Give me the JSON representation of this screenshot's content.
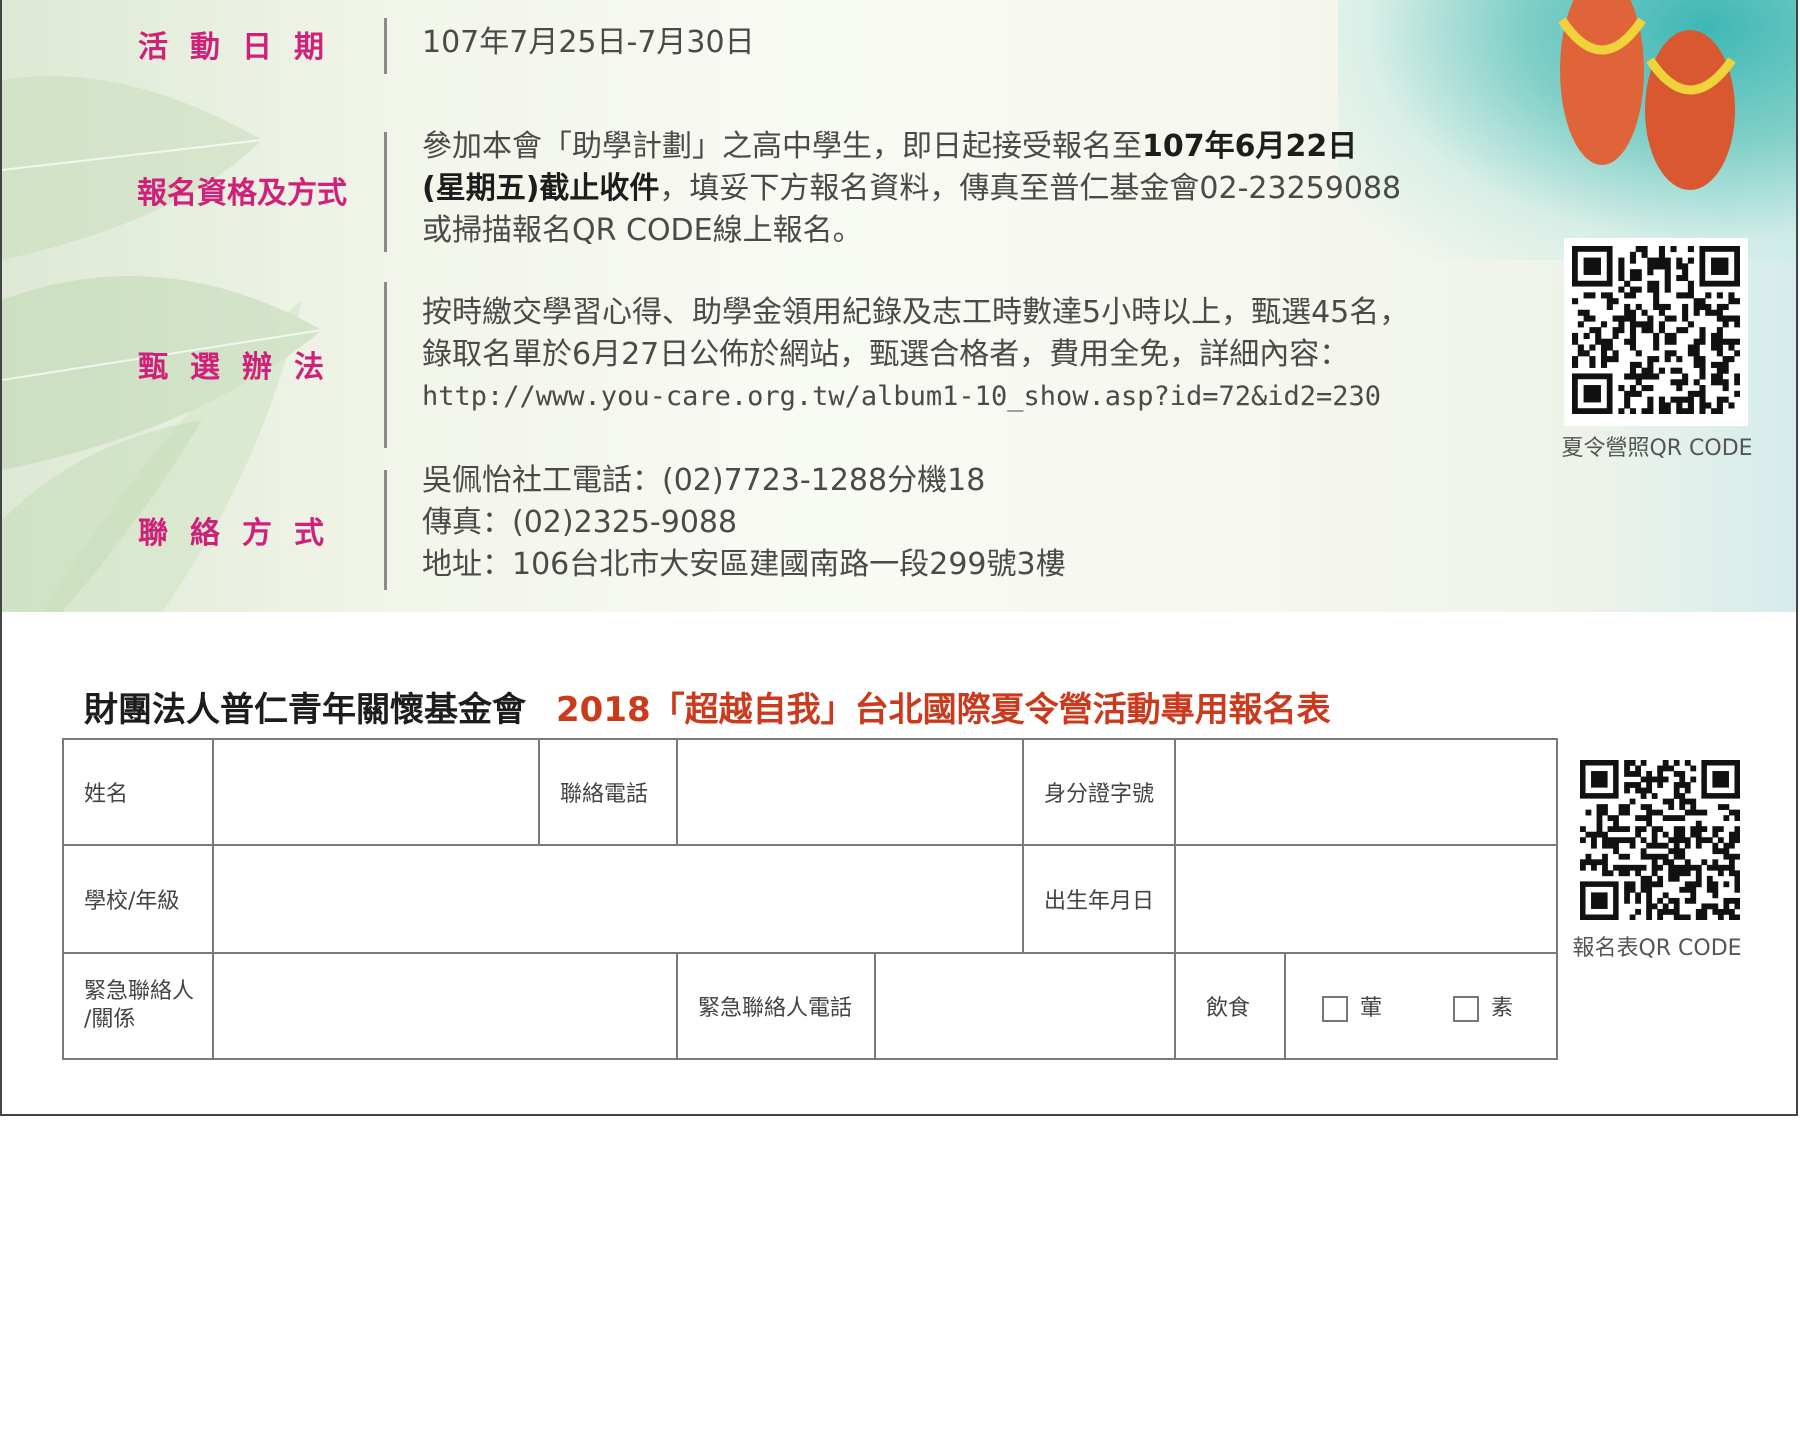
{
  "event_info": {
    "rows": [
      {
        "label": "活動日期",
        "lines": [
          "107年7月25日-7月30日"
        ]
      },
      {
        "label": "報名資格及方式",
        "line1_pre": "參加本會「助學計劃」之高中學生，即日起接受報名至",
        "line1_bold": "107年6月22日",
        "line2_bold": "(星期五)截止收件",
        "line2_post": "，填妥下方報名資料，傳真至普仁基金會02-23259088",
        "line3": "或掃描報名QR CODE線上報名。"
      },
      {
        "label": "甄選辦法",
        "lines": [
          "按時繳交學習心得、助學金領用紀錄及志工時數達5小時以上，甄選45名，",
          "錄取名單於6月27日公佈於網站，甄選合格者，費用全免，詳細內容：",
          "http://www.you-care.org.tw/album1-10_show.asp?id=72&id2=230"
        ]
      },
      {
        "label": "聯絡方式",
        "lines": [
          "吳佩怡社工電話：(02)7723-1288分機18",
          "傳真：(02)2325-9088",
          "地址：106台北市大安區建國南路一段299號3樓"
        ]
      }
    ],
    "qr_caption": "夏令營照QR CODE"
  },
  "form": {
    "org": "財團法人普仁青年關懷基金會",
    "title": "2018「超越自我」台北國際夏令營活動專用報名表",
    "labels": {
      "name": "姓名",
      "phone": "聯絡電話",
      "id_number": "身分證字號",
      "school_grade": "學校/年級",
      "birthdate": "出生年月日",
      "emergency_contact_line1": "緊急聯絡人",
      "emergency_contact_line2": "/關係",
      "emergency_phone": "緊急聯絡人電話",
      "diet": "飲食",
      "meat": "葷",
      "veg": "素"
    },
    "qr_caption": "報名表QR CODE"
  },
  "colors": {
    "label_pink": "#d0207a",
    "title_red": "#cc3a1e",
    "text_gray": "#4a4a4a"
  },
  "icons": [
    "flip-flops-icon",
    "qr-code-icon",
    "checkbox-icon"
  ]
}
